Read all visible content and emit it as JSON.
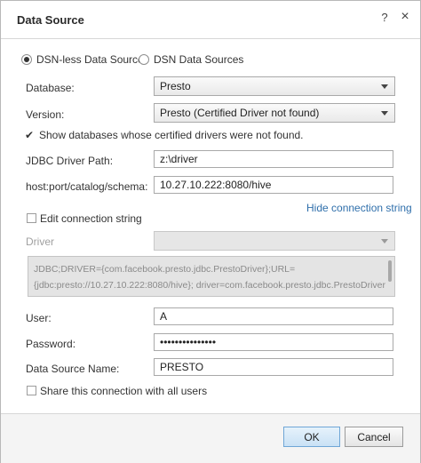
{
  "dialog": {
    "title": "Data Source",
    "help_label": "?",
    "close_label": "×"
  },
  "mode": {
    "options": [
      {
        "label": "DSN-less Data Sources",
        "selected": true
      },
      {
        "label": "DSN Data Sources",
        "selected": false
      }
    ]
  },
  "form": {
    "database": {
      "label": "Database:",
      "value": "Presto"
    },
    "version": {
      "label": "Version:",
      "value": "Presto (Certified Driver not found)"
    },
    "show_uncertified": {
      "label": "Show databases whose certified drivers were not found.",
      "checked": true
    },
    "jdbc_path": {
      "label": "JDBC Driver Path:",
      "value": "z:\\driver"
    },
    "host": {
      "label": "host:port/catalog/schema:",
      "value": "10.27.10.222:8080/hive"
    },
    "hide_link": "Hide connection string",
    "edit_connection": {
      "label": "Edit connection string",
      "checked": false
    },
    "driver": {
      "label": "Driver",
      "value": ""
    },
    "connection_string": {
      "line1": "JDBC;DRIVER={com.facebook.presto.jdbc.PrestoDriver};URL=",
      "line2": "{jdbc:presto://10.27.10.222:8080/hive}; driver=com.facebook.presto.jdbc.PrestoDriver"
    },
    "user": {
      "label": "User:",
      "value": "A"
    },
    "password": {
      "label": "Password:",
      "value": "•••••••••••••••"
    },
    "dsn_name": {
      "label": "Data Source Name:",
      "value": "PRESTO"
    },
    "share": {
      "label": "Share this connection with all users",
      "checked": false
    }
  },
  "buttons": {
    "ok": "OK",
    "cancel": "Cancel"
  },
  "colors": {
    "accent": "#2f6fab",
    "primary_button": "#c9e1f5"
  }
}
